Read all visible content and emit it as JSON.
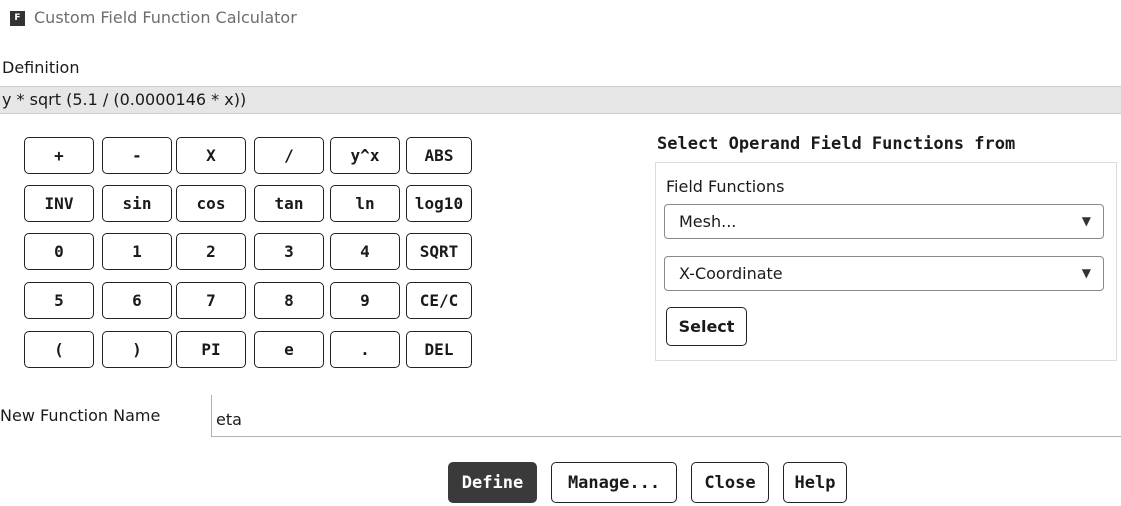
{
  "window": {
    "icon_letter": "F",
    "title": "Custom Field Function Calculator"
  },
  "definition": {
    "label": "Definition",
    "value": "y * sqrt (5.1 / (0.0000146 * x))"
  },
  "keypad": {
    "rows": [
      [
        "+",
        "-",
        "X",
        "/",
        "y^x",
        "ABS"
      ],
      [
        "INV",
        "sin",
        "cos",
        "tan",
        "ln",
        "log10"
      ],
      [
        "0",
        "1",
        "2",
        "3",
        "4",
        "SQRT"
      ],
      [
        "5",
        "6",
        "7",
        "8",
        "9",
        "CE/C"
      ],
      [
        "(",
        ")",
        "PI",
        "e",
        ".",
        "DEL"
      ]
    ]
  },
  "operand": {
    "title": "Select Operand Field Functions from",
    "field_functions_label": "Field Functions",
    "category_value": "Mesh...",
    "function_value": "X-Coordinate",
    "select_label": "Select"
  },
  "new_function": {
    "label": "New Function Name",
    "value": "eta"
  },
  "buttons": {
    "define": "Define",
    "manage": "Manage...",
    "close": "Close",
    "help": "Help"
  }
}
